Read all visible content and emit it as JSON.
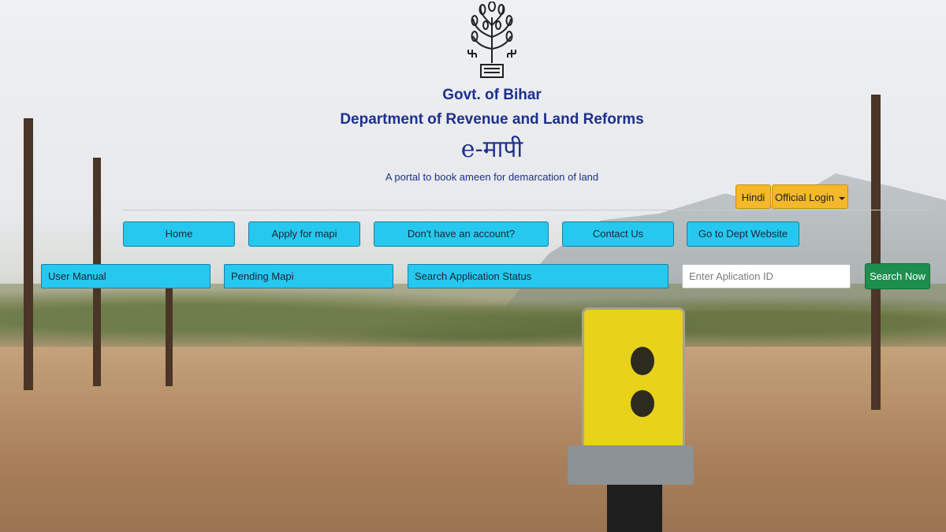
{
  "header": {
    "govt": "Govt. of Bihar",
    "department": "Department of Revenue and Land Reforms",
    "portal_name": "e-मापी",
    "tagline": "A portal to book ameen for demarcation of land"
  },
  "top_buttons": {
    "hindi": "Hindi",
    "official_login": "Official Login"
  },
  "nav": {
    "home": "Home",
    "apply": "Apply for mapi",
    "register": "Don't have an account?",
    "contact": "Contact Us",
    "dept_site": "Go to Dept Website"
  },
  "quick_links": {
    "user_manual": "User Manual",
    "pending": "Pending Mapi",
    "search_status": "Search Application Status"
  },
  "search": {
    "placeholder": "Enter Aplication ID",
    "button": "Search Now"
  },
  "colors": {
    "heading": "#1d2f8f",
    "nav_button": "#27c8ef",
    "yellow_button": "#f4b82a",
    "search_button": "#1e8e4f"
  },
  "icons": {
    "emblem": "bihar-emblem-icon",
    "dropdown": "caret-down-icon"
  }
}
